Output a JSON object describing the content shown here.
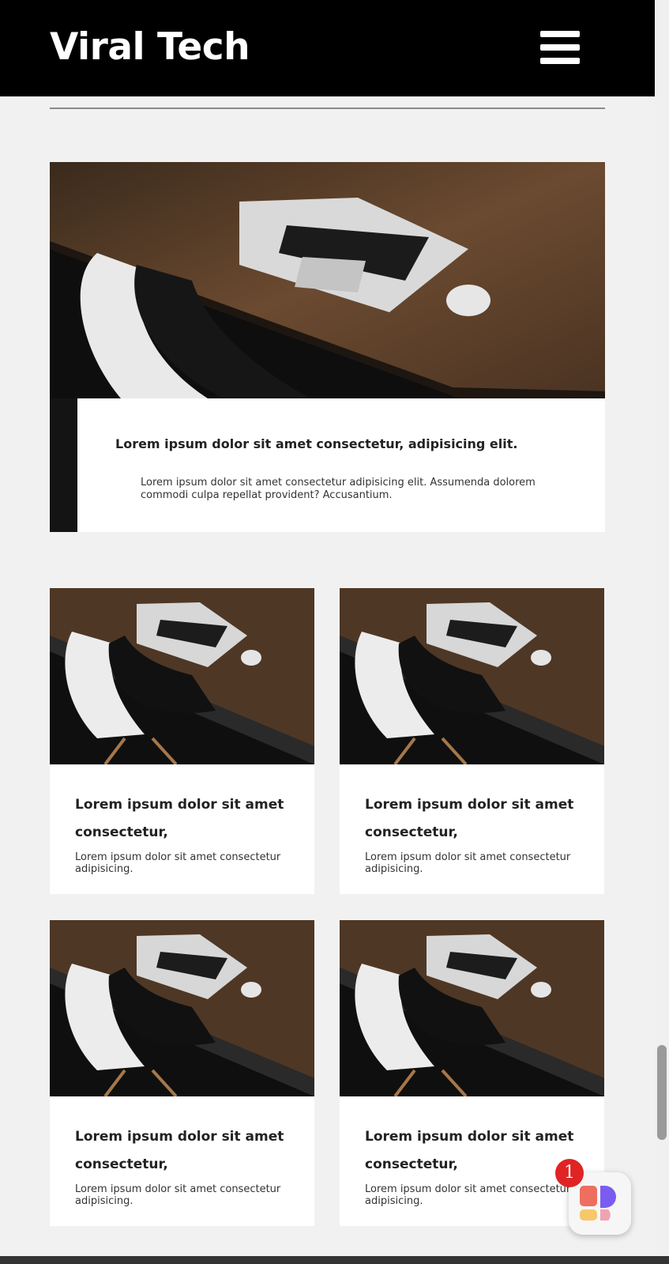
{
  "header": {
    "brand": "Viral Tech",
    "menu_icon": "hamburger-menu-icon"
  },
  "hero": {
    "image": "laptop-on-desk-with-chair",
    "title": "Lorem ipsum dolor sit amet consectetur, adipisicing elit.",
    "text": "Lorem ipsum dolor sit amet consectetur adipisicing elit. Assumenda dolorem commodi culpa repellat provident? Accusantium."
  },
  "cards": [
    {
      "title": "Lorem ipsum dolor sit amet consectetur,",
      "text": "Lorem ipsum dolor sit amet consectetur adipisicing."
    },
    {
      "title": "Lorem ipsum dolor sit amet consectetur,",
      "text": "Lorem ipsum dolor sit amet consectetur adipisicing."
    },
    {
      "title": "Lorem ipsum dolor sit amet consectetur,",
      "text": "Lorem ipsum dolor sit amet consectetur adipisicing."
    },
    {
      "title": "Lorem ipsum dolor sit amet consectetur,",
      "text": "Lorem ipsum dolor sit amet consectetur adipisicing."
    }
  ],
  "widget": {
    "icon": "app-launcher-icon",
    "badge_count": "1"
  },
  "colors": {
    "header_bg": "#000000",
    "page_bg": "#f1f1f1",
    "badge": "#e02424"
  }
}
